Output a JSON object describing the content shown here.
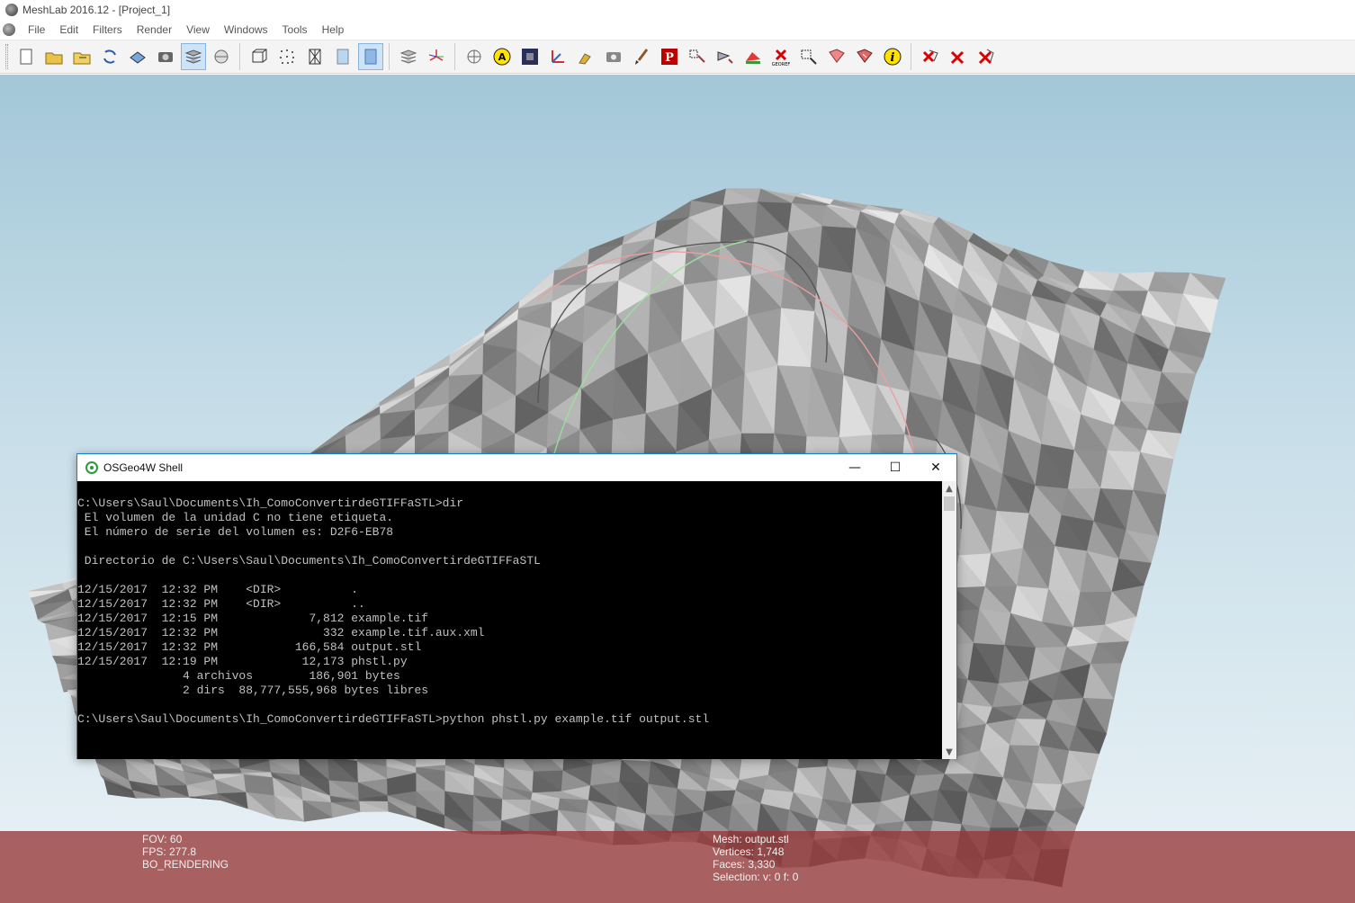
{
  "window": {
    "title": "MeshLab 2016.12 - [Project_1]"
  },
  "menu": {
    "items": [
      "File",
      "Edit",
      "Filters",
      "Render",
      "View",
      "Windows",
      "Tools",
      "Help"
    ]
  },
  "toolbar": {
    "groups": [
      [
        "new-project-icon",
        "open-project-icon",
        "open-mesh-icon",
        "reload-icon",
        "save-snapshot-icon",
        "camera-icon",
        "layers-icon",
        "sphere-icon"
      ],
      [
        "bbox-icon",
        "points-icon",
        "wireframe-icon",
        "flat-icon",
        "smooth-icon"
      ],
      [
        "layer-stack-icon",
        "axes-icon"
      ],
      [
        "globe-icon",
        "annotation-a-icon",
        "raster-icon",
        "align-axes-icon",
        "paint-icon",
        "camera-align-icon",
        "brush-icon",
        "pp-icon",
        "edit-select-icon",
        "edit-move-icon",
        "color-icon",
        "georef-icon",
        "select-faces-icon",
        "select-vertices-icon",
        "z-painting-icon",
        "info-icon"
      ],
      [
        "delete-faces-icon",
        "delete-vertices-icon",
        "delete-all-icon"
      ]
    ],
    "active": [
      "layers-icon",
      "smooth-icon"
    ]
  },
  "status": {
    "fov": "FOV: 60",
    "fps": "FPS:   277.8",
    "render": "BO_RENDERING",
    "mesh": "Mesh: output.stl",
    "vertices": "Vertices: 1,748",
    "faces": "Faces: 3,330",
    "selection": "Selection: v: 0 f: 0"
  },
  "shell": {
    "title": "OSGeo4W Shell",
    "minimize": "—",
    "maximize": "☐",
    "close": "✕",
    "lines": [
      "C:\\Users\\Saul\\Documents\\Ih_ComoConvertirdeGTIFFaSTL>dir",
      " El volumen de la unidad C no tiene etiqueta.",
      " El número de serie del volumen es: D2F6-EB78",
      "",
      " Directorio de C:\\Users\\Saul\\Documents\\Ih_ComoConvertirdeGTIFFaSTL",
      "",
      "12/15/2017  12:32 PM    <DIR>          .",
      "12/15/2017  12:32 PM    <DIR>          ..",
      "12/15/2017  12:15 PM             7,812 example.tif",
      "12/15/2017  12:32 PM               332 example.tif.aux.xml",
      "12/15/2017  12:32 PM           166,584 output.stl",
      "12/15/2017  12:19 PM            12,173 phstl.py",
      "               4 archivos        186,901 bytes",
      "               2 dirs  88,777,555,968 bytes libres",
      "",
      "C:\\Users\\Saul\\Documents\\Ih_ComoConvertirdeGTIFFaSTL>python phstl.py example.tif output.stl"
    ]
  }
}
